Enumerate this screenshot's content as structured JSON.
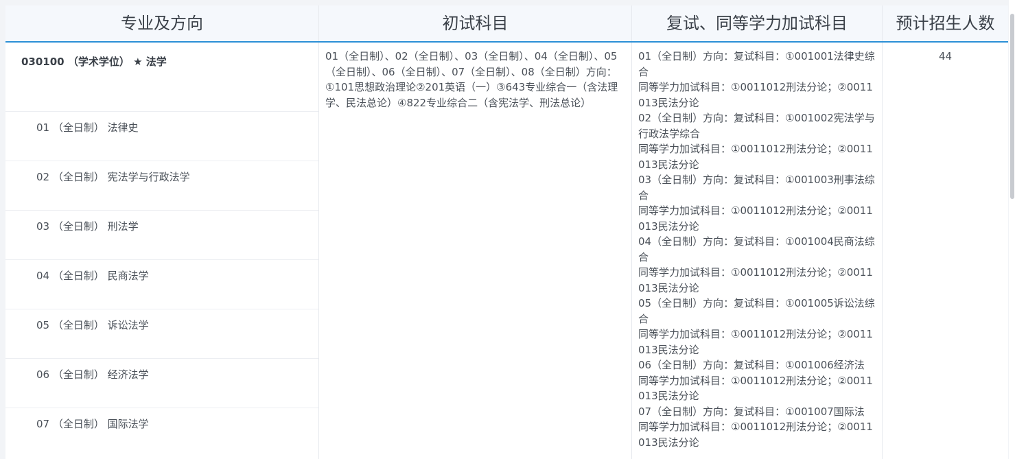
{
  "headers": {
    "major": "专业及方向",
    "initial": "初试科目",
    "retest": "复试、同等学力加试科目",
    "quota": "预计招生人数"
  },
  "major": {
    "title": "030100 （学术学位） ★ 法学",
    "directions": [
      "01 （全日制） 法律史",
      "02 （全日制） 宪法学与行政法学",
      "03 （全日制） 刑法学",
      "04 （全日制） 民商法学",
      "05 （全日制） 诉讼法学",
      "06 （全日制） 经济法学",
      "07 （全日制） 国际法学"
    ]
  },
  "initial_subjects": "01（全日制）、02（全日制）、03（全日制）、04（全日制）、05（全日制）、06（全日制）、07（全日制）、08（全日制）方向：①101思想政治理论②201英语（一）③643专业综合一（含法理学、民法总论）④822专业综合二（含宪法学、刑法总论）",
  "retest_lines": [
    "01（全日制）方向：复试科目：①001001法律史综合",
    "同等学力加试科目：①0011012刑法分论；②0011013民法分论",
    "02（全日制）方向：复试科目：①001002宪法学与行政法学综合",
    "同等学力加试科目：①0011012刑法分论；②0011013民法分论",
    "03（全日制）方向：复试科目：①001003刑事法综合",
    "同等学力加试科目：①0011012刑法分论；②0011013民法分论",
    "04（全日制）方向：复试科目：①001004民商法综合",
    "同等学力加试科目：①0011012刑法分论；②0011013民法分论",
    "05（全日制）方向：复试科目：①001005诉讼法综合",
    "同等学力加试科目：①0011012刑法分论；②0011013民法分论",
    "06（全日制）方向：复试科目：①001006经济法",
    "同等学力加试科目：①0011012刑法分论；②0011013民法分论",
    "07（全日制）方向：复试科目：①001007国际法",
    "同等学力加试科目：①0011012刑法分论；②0011013民法分论"
  ],
  "quota": "44",
  "colors": {
    "accent": "#2b8fd6",
    "header_bg": "#f5f8fc",
    "text": "#4a5058"
  }
}
